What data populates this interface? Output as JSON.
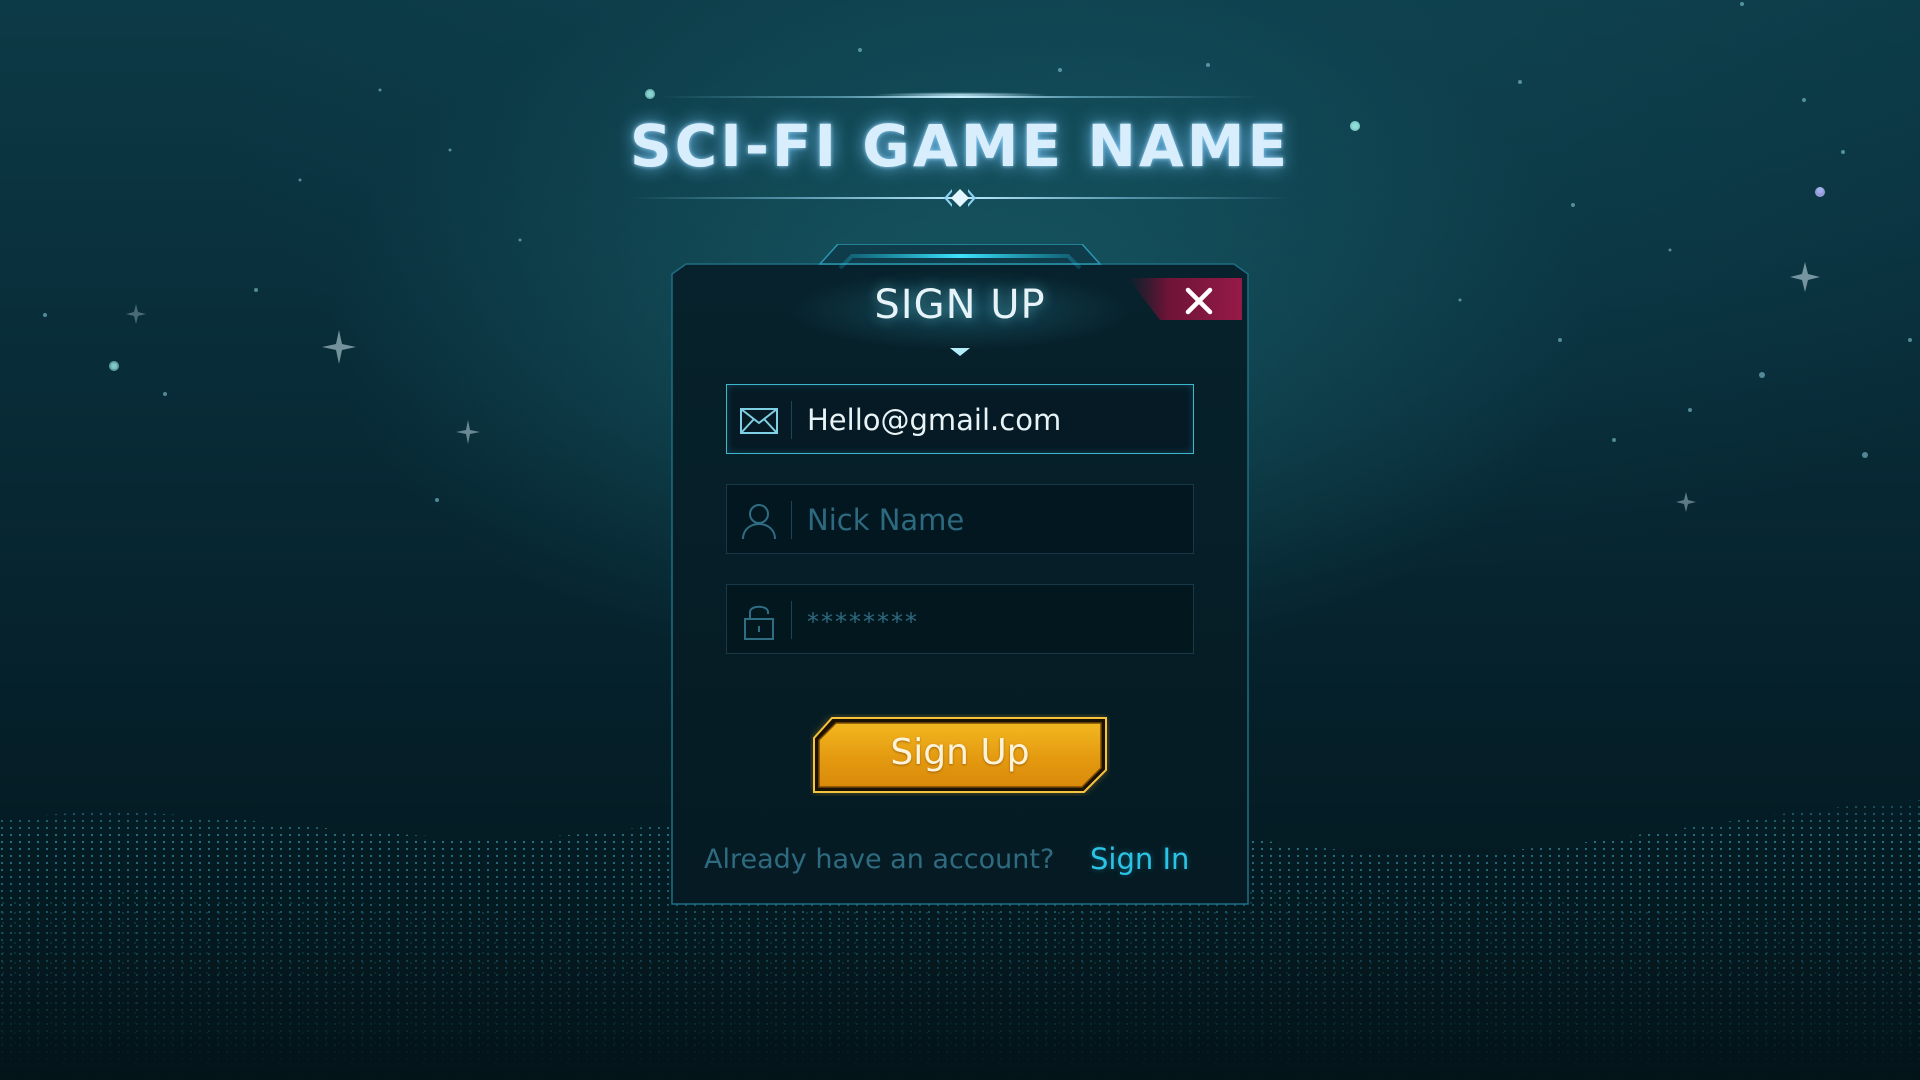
{
  "game": {
    "title": "SCI-FI GAME NAME"
  },
  "dialog": {
    "title": "SIGN UP",
    "close_icon": "close-icon",
    "fields": {
      "email": {
        "icon": "envelope-icon",
        "value": "Hello@gmail.com",
        "placeholder": ""
      },
      "nickname": {
        "icon": "user-icon",
        "value": "",
        "placeholder": "Nick Name"
      },
      "password": {
        "icon": "lock-icon",
        "value": "",
        "placeholder": "********"
      }
    },
    "submit_label": "Sign Up",
    "footer": {
      "prompt": "Already have an account?",
      "link_label": "Sign In"
    }
  },
  "colors": {
    "accent": "#2bc4e6",
    "button": "#e8a414",
    "close": "#8a1840",
    "background": "#072631"
  }
}
